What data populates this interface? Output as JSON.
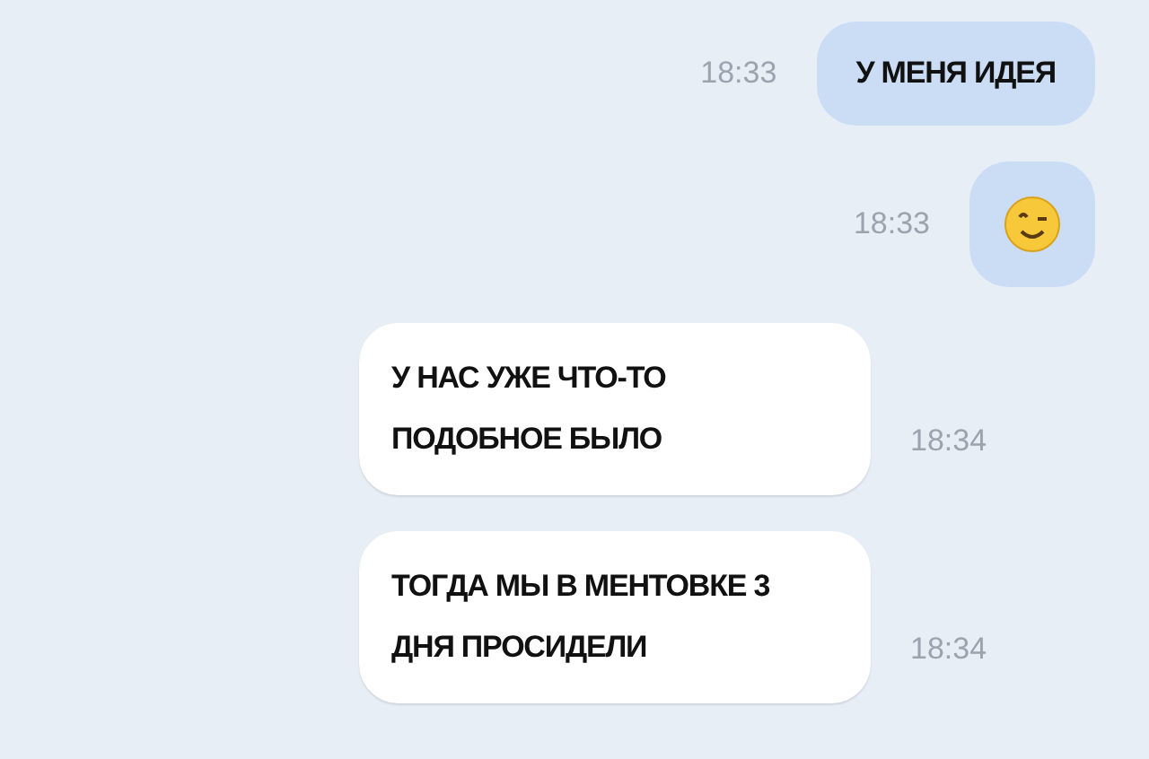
{
  "messages": [
    {
      "kind": "text",
      "outgoing": true,
      "text": "У МЕНЯ ИДЕЯ",
      "time": "18:33"
    },
    {
      "kind": "emoji",
      "outgoing": true,
      "time": "18:33"
    },
    {
      "kind": "text",
      "outgoing": false,
      "text": "У НАС УЖЕ ЧТО-ТО ПОДОБНОЕ БЫЛО",
      "time": "18:34"
    },
    {
      "kind": "text",
      "outgoing": false,
      "text": "ТОГДА МЫ В МЕНТОВКЕ 3 ДНЯ ПРОСИДЕЛИ",
      "time": "18:34"
    }
  ]
}
